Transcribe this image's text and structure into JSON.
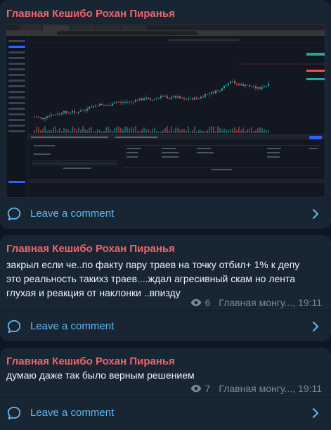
{
  "posts": [
    {
      "author": "Главная Кешибо Рохан Пиранья",
      "comment_label": "Leave a comment"
    },
    {
      "author": "Главная Кешибо Рохан Пиранья",
      "text_lines": [
        "закрыл если че..по факту пару траев на точку отбил+ 1% к депу",
        "это реальность такихз траев....ждал агресивный скам но лента",
        "глухая и реакция от наклонки ..впизду"
      ],
      "views": "6",
      "channel": "Главная монгу...,",
      "time": "19:11",
      "comment_label": "Leave a comment"
    },
    {
      "author": "Главная Кешибо Рохан Пиранья",
      "text_lines": [
        "думаю даже так было верным решением"
      ],
      "views": "7",
      "channel": "Главная монгу...,",
      "time": "19:11",
      "comment_label": "Leave a comment"
    }
  ],
  "colors": {
    "author": "#f2636b",
    "link": "#64b5ef",
    "meta": "#7b8a98",
    "card": "#182533",
    "bg": "#0e1621",
    "candle_up": "#26a69a",
    "candle_down": "#ef5350"
  },
  "icons": {
    "comment": "speech-bubble-icon",
    "chevron": "chevron-right-icon",
    "views": "eye-icon"
  }
}
